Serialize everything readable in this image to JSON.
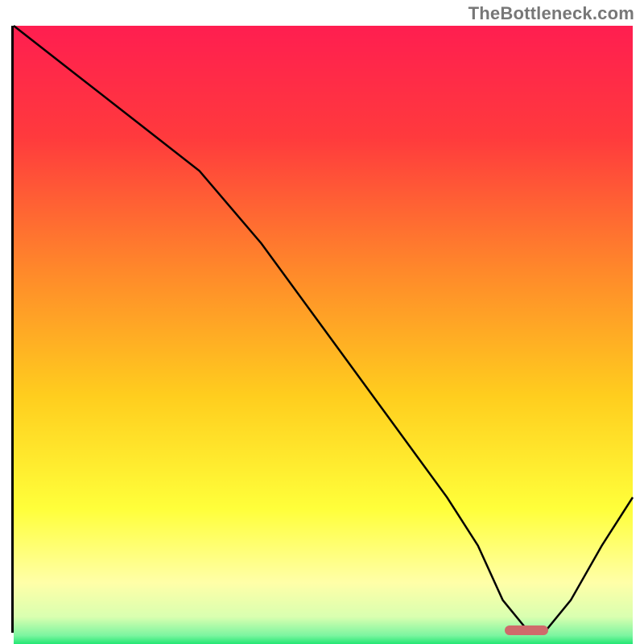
{
  "attribution": "TheBottleneck.com",
  "chart_data": {
    "type": "line",
    "title": "",
    "xlabel": "",
    "ylabel": "",
    "xlim": [
      0,
      100
    ],
    "ylim": [
      0,
      100
    ],
    "x": [
      0,
      10,
      20,
      30,
      40,
      50,
      60,
      65,
      70,
      75,
      79,
      83,
      86,
      90,
      95,
      100
    ],
    "values": [
      100,
      92,
      84,
      76,
      64,
      50,
      36,
      29,
      22,
      14,
      5,
      0,
      0,
      5,
      14,
      22
    ],
    "gradient_stops": [
      {
        "offset": 0.0,
        "color": "#ff1e50"
      },
      {
        "offset": 0.18,
        "color": "#ff3a3d"
      },
      {
        "offset": 0.4,
        "color": "#ff8a2a"
      },
      {
        "offset": 0.6,
        "color": "#ffce1e"
      },
      {
        "offset": 0.78,
        "color": "#ffff3a"
      },
      {
        "offset": 0.9,
        "color": "#ffffa8"
      },
      {
        "offset": 0.955,
        "color": "#d9ffb0"
      },
      {
        "offset": 0.985,
        "color": "#7cf5a0"
      },
      {
        "offset": 1.0,
        "color": "#1ae66f"
      }
    ],
    "optimal_range": {
      "x_start": 79,
      "x_end": 86,
      "color": "#cf6a6b"
    }
  }
}
